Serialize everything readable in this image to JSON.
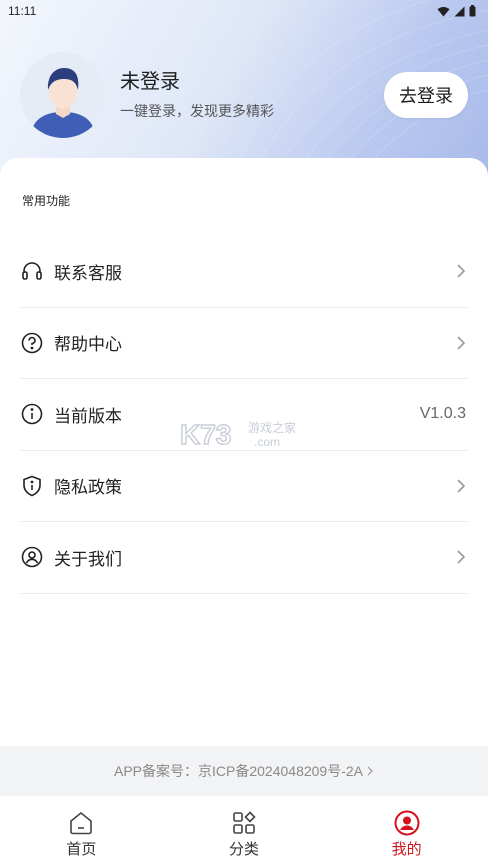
{
  "status_bar": {
    "time": "11:11",
    "icons": [
      "wifi-icon",
      "signal-icon",
      "battery-icon"
    ]
  },
  "profile": {
    "name": "未登录",
    "subtitle": "一键登录，发现更多精彩",
    "login_button": "去登录",
    "avatar_icon": "user-avatar-icon"
  },
  "section_title": "常用功能",
  "menu": {
    "items": [
      {
        "label": "联系客服",
        "icon": "headset-icon",
        "value": "",
        "chevron": true
      },
      {
        "label": "帮助中心",
        "icon": "question-circle-icon",
        "value": "",
        "chevron": true
      },
      {
        "label": "当前版本",
        "icon": "info-circle-icon",
        "value": "V1.0.3",
        "chevron": false
      },
      {
        "label": "隐私政策",
        "icon": "shield-info-icon",
        "value": "",
        "chevron": true
      },
      {
        "label": "关于我们",
        "icon": "user-circle-icon",
        "value": "",
        "chevron": true
      }
    ]
  },
  "watermark": {
    "logo": "K73",
    "text": "游戏之家",
    "domain": ".com"
  },
  "footer": {
    "icp_text": "APP备案号：京ICP备2024048209号-2A"
  },
  "tabbar": {
    "tabs": [
      {
        "label": "首页",
        "icon": "home-icon",
        "active": false
      },
      {
        "label": "分类",
        "icon": "category-grid-icon",
        "active": false
      },
      {
        "label": "我的",
        "icon": "profile-icon",
        "active": true
      }
    ]
  },
  "colors": {
    "accent": "#d3141e",
    "header_gradient_end": "#a7b9ea",
    "footer_bg": "#f2f3f5"
  }
}
